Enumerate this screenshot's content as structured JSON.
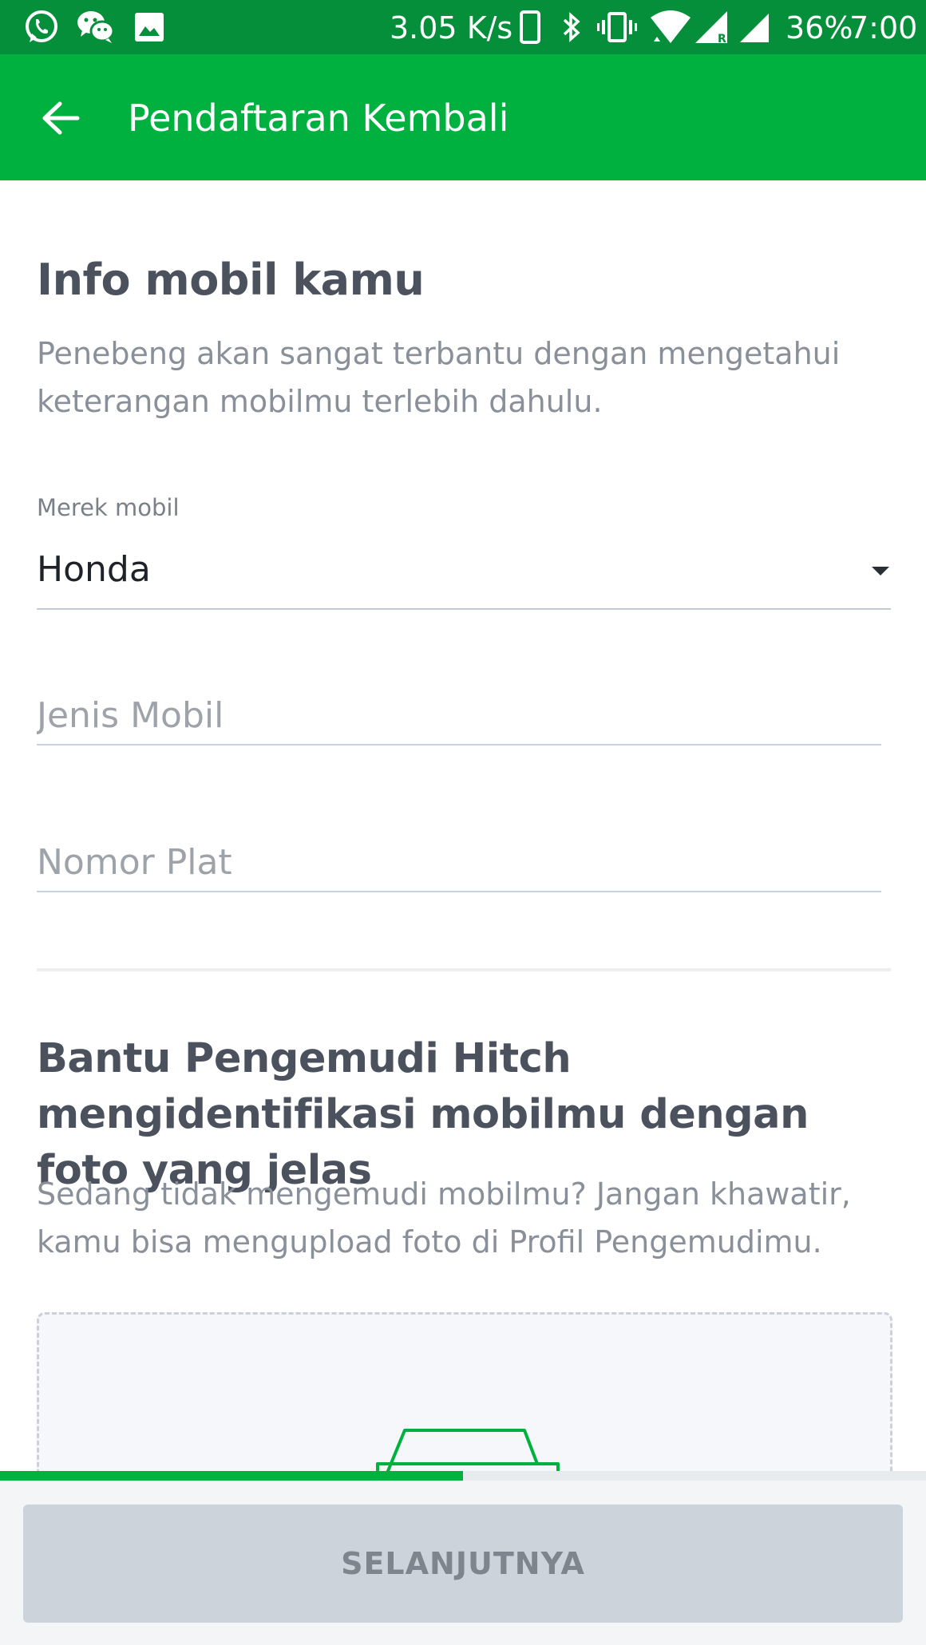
{
  "status_bar": {
    "network_speed": "3.05 K/s",
    "battery": "36%",
    "time": "7:00",
    "icons": [
      "whatsapp-icon",
      "wechat-icon",
      "image-icon",
      "phone-icon",
      "bluetooth-icon",
      "vibrate-icon",
      "wifi-icon",
      "signal-roaming-icon",
      "signal-icon"
    ]
  },
  "app_bar": {
    "title": "Pendaftaran Kembali",
    "back_icon": "arrow-back-icon"
  },
  "car_info": {
    "heading": "Info mobil kamu",
    "description": "Penebeng akan sangat terbantu dengan mengetahui keterangan mobilmu terlebih dahulu.",
    "brand_label": "Merek mobil",
    "brand_value": "Honda",
    "type_placeholder": "Jenis Mobil",
    "type_value": "",
    "plate_placeholder": "Nomor Plat",
    "plate_value": ""
  },
  "photo_section": {
    "heading": "Bantu Pengemudi Hitch mengidentifikasi mobilmu dengan foto yang jelas",
    "description": "Sedang tidak mengemudi mobilmu? Jangan khawatir, kamu bisa mengupload foto di Profil Pengemudimu.",
    "upload_icon": "car-photo-icon"
  },
  "progress": {
    "fraction": 0.5
  },
  "footer": {
    "next_label": "SELANJUTNYA"
  },
  "colors": {
    "status_bar": "#058f3a",
    "app_bar": "#00b140",
    "accent": "#00b140",
    "button_disabled": "#cdd3da"
  }
}
